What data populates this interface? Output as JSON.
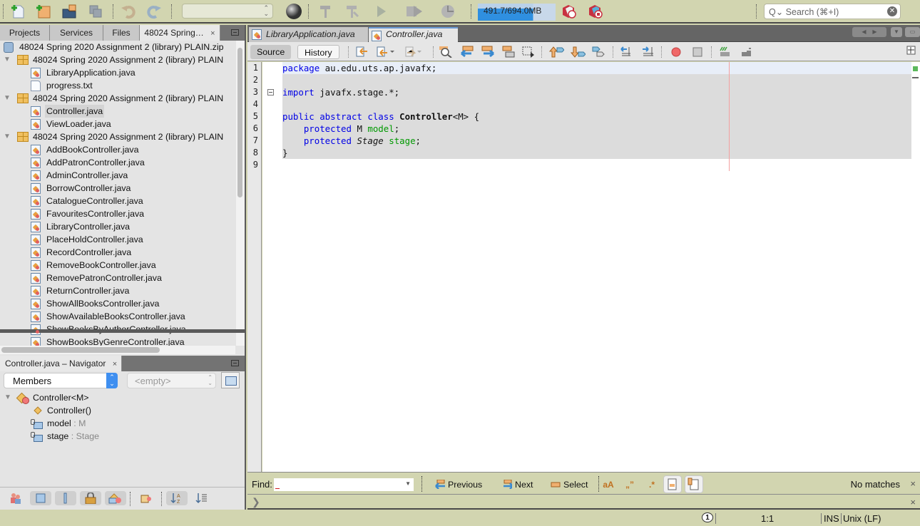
{
  "toolbar": {
    "config_value": "",
    "memory": "491.7/694.0MB",
    "memory_usage_fraction": 0.708,
    "search_placeholder": "Search (⌘+I)"
  },
  "projects_panel": {
    "tabs": [
      {
        "label": "Projects",
        "active": false
      },
      {
        "label": "Services",
        "active": false
      },
      {
        "label": "Files",
        "active": false
      },
      {
        "label": "48024 Spring…",
        "active": true,
        "close": "×"
      }
    ],
    "tree": [
      {
        "label": "48024 Spring 2020 Assignment 2 (library) PLAIN.zip",
        "type": "zip",
        "level": 0
      },
      {
        "label": "48024 Spring 2020 Assignment 2 (library) PLAIN",
        "type": "package",
        "level": 1,
        "expanded": true
      },
      {
        "label": "LibraryApplication.java",
        "type": "java",
        "level": 2
      },
      {
        "label": "progress.txt",
        "type": "txt",
        "level": 2
      },
      {
        "label": "48024 Spring 2020 Assignment 2 (library) PLAIN",
        "type": "package",
        "level": 1,
        "expanded": true
      },
      {
        "label": "Controller.java",
        "type": "java",
        "level": 2,
        "selected": true
      },
      {
        "label": "ViewLoader.java",
        "type": "java",
        "level": 2
      },
      {
        "label": "48024 Spring 2020 Assignment 2 (library) PLAIN",
        "type": "package",
        "level": 1,
        "expanded": true
      },
      {
        "label": "AddBookController.java",
        "type": "java",
        "level": 2
      },
      {
        "label": "AddPatronController.java",
        "type": "java",
        "level": 2
      },
      {
        "label": "AdminController.java",
        "type": "java",
        "level": 2
      },
      {
        "label": "BorrowController.java",
        "type": "java",
        "level": 2
      },
      {
        "label": "CatalogueController.java",
        "type": "java",
        "level": 2
      },
      {
        "label": "FavouritesController.java",
        "type": "java",
        "level": 2
      },
      {
        "label": "LibraryController.java",
        "type": "java",
        "level": 2
      },
      {
        "label": "PlaceHoldController.java",
        "type": "java",
        "level": 2
      },
      {
        "label": "RecordController.java",
        "type": "java",
        "level": 2
      },
      {
        "label": "RemoveBookController.java",
        "type": "java",
        "level": 2
      },
      {
        "label": "RemovePatronController.java",
        "type": "java",
        "level": 2
      },
      {
        "label": "ReturnController.java",
        "type": "java",
        "level": 2
      },
      {
        "label": "ShowAllBooksController.java",
        "type": "java",
        "level": 2
      },
      {
        "label": "ShowAvailableBooksController.java",
        "type": "java",
        "level": 2
      },
      {
        "label": "ShowBooksByAuthorController.java",
        "type": "java",
        "level": 2
      },
      {
        "label": "ShowBooksByGenreController.java",
        "type": "java",
        "level": 2
      }
    ]
  },
  "navigator": {
    "tab_label": "Controller.java – Navigator",
    "close": "×",
    "filter_value": "Members",
    "scope_value": "<empty>",
    "tree": [
      {
        "label": "Controller<M>",
        "type": "class",
        "type_suffix": ""
      },
      {
        "label": "Controller()",
        "type": "constructor",
        "type_suffix": ""
      },
      {
        "label": "model",
        "type": "field",
        "type_suffix": " : M"
      },
      {
        "label": "stage",
        "type": "field",
        "type_suffix": " : Stage"
      }
    ]
  },
  "editor": {
    "tabs": [
      {
        "label": "LibraryApplication.java",
        "active": false,
        "close": "×"
      },
      {
        "label": "Controller.java",
        "active": true,
        "close": "×"
      }
    ],
    "views": {
      "source": "Source",
      "history": "History"
    },
    "line_numbers": [
      "1",
      "2",
      "3",
      "4",
      "5",
      "6",
      "7",
      "8",
      "9"
    ],
    "code": {
      "l1_kw": "package",
      "l1_rest": " au.edu.uts.ap.javafx;",
      "l3_kw": "import",
      "l3_rest": " javafx.stage.*;",
      "l5_kw": "public abstract class",
      "l5_cls": "Controller",
      "l5_rest": "<M> {",
      "l6_kw": "    protected",
      "l6_type": " M ",
      "l6_fld": "model",
      "l6_end": ";",
      "l7_kw": "    protected",
      "l7_type": "Stage",
      "l7_fld": "stage",
      "l7_end": ";",
      "l8": "}"
    }
  },
  "find_bar": {
    "label": "Find:",
    "value": "",
    "previous": "Previous",
    "next": "Next",
    "select": "Select",
    "status": "No matches",
    "close": "×"
  },
  "output_bar": {
    "close": "×"
  },
  "status_bar": {
    "notifications": "1",
    "caret_position": "1:1",
    "insert_mode": "INS",
    "line_endings": "Unix (LF)"
  }
}
